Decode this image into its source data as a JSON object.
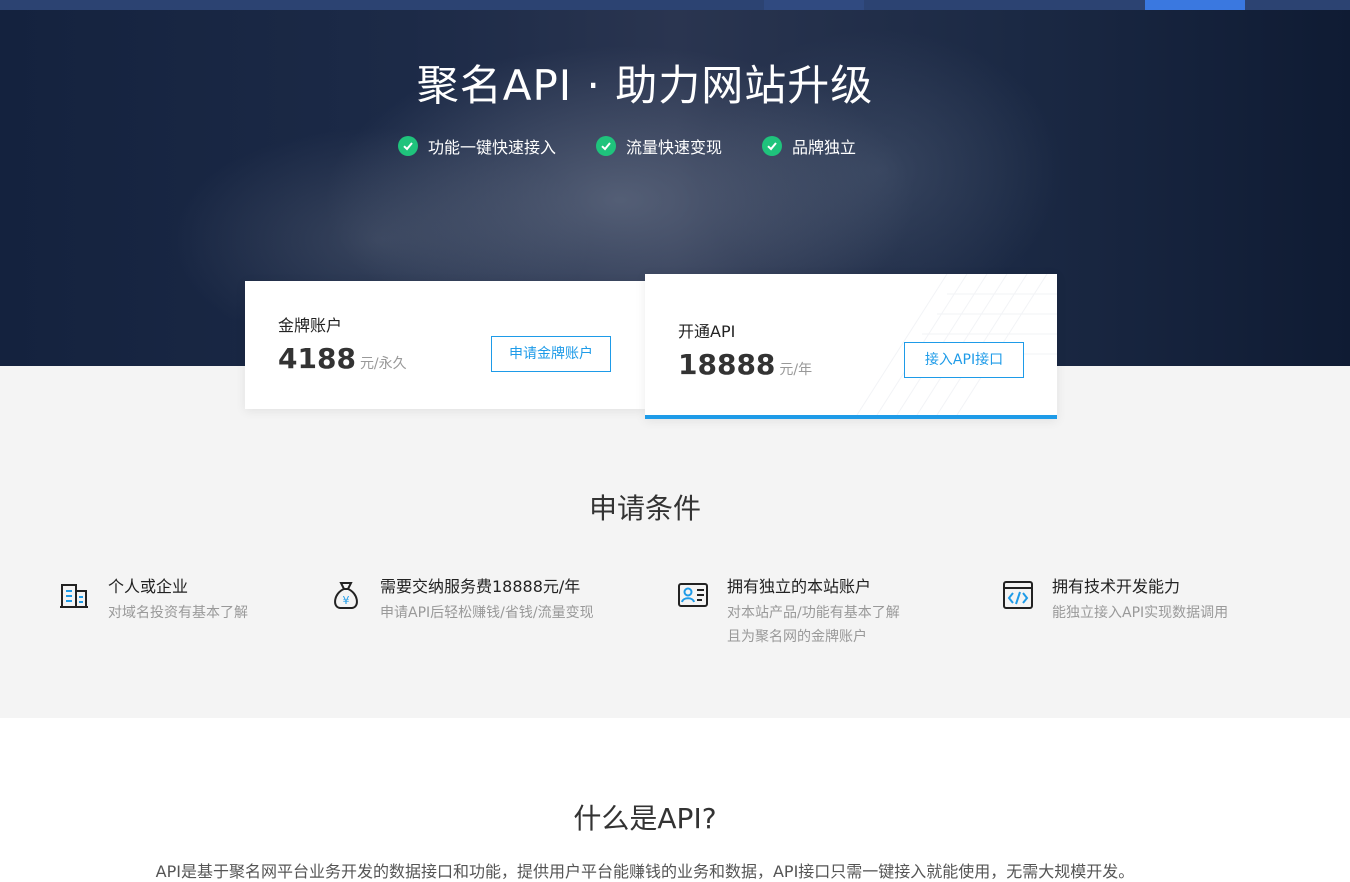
{
  "hero": {
    "title": "聚名API · 助力网站升级",
    "features": [
      "功能一键快速接入",
      "流量快速变现",
      "品牌独立"
    ]
  },
  "cards": {
    "gold": {
      "label": "金牌账户",
      "price": "4188",
      "unit": "元/永久",
      "button": "申请金牌账户"
    },
    "api": {
      "label": "开通API",
      "price": "18888",
      "unit": "元/年",
      "button": "接入API接口"
    }
  },
  "conditions": {
    "title": "申请条件",
    "items": [
      {
        "icon": "building-icon",
        "title": "个人或企业",
        "desc": [
          "对域名投资有基本了解"
        ]
      },
      {
        "icon": "money-bag-icon",
        "title": "需要交纳服务费18888元/年",
        "desc": [
          "申请API后轻松赚钱/省钱/流量变现"
        ]
      },
      {
        "icon": "id-card-icon",
        "title": "拥有独立的本站账户",
        "desc": [
          "对本站产品/功能有基本了解",
          "且为聚名网的金牌账户"
        ]
      },
      {
        "icon": "code-window-icon",
        "title": "拥有技术开发能力",
        "desc": [
          "能独立接入API实现数据调用"
        ]
      }
    ]
  },
  "about": {
    "title": "什么是API?",
    "desc": "API是基于聚名网平台业务开发的数据接口和功能，提供用户平台能赚钱的业务和数据，API接口只需一键接入就能使用，无需大规模开发。"
  },
  "colors": {
    "accent": "#1e9be8",
    "check": "#1fc37c",
    "topbar_active": "#3a78e0"
  }
}
